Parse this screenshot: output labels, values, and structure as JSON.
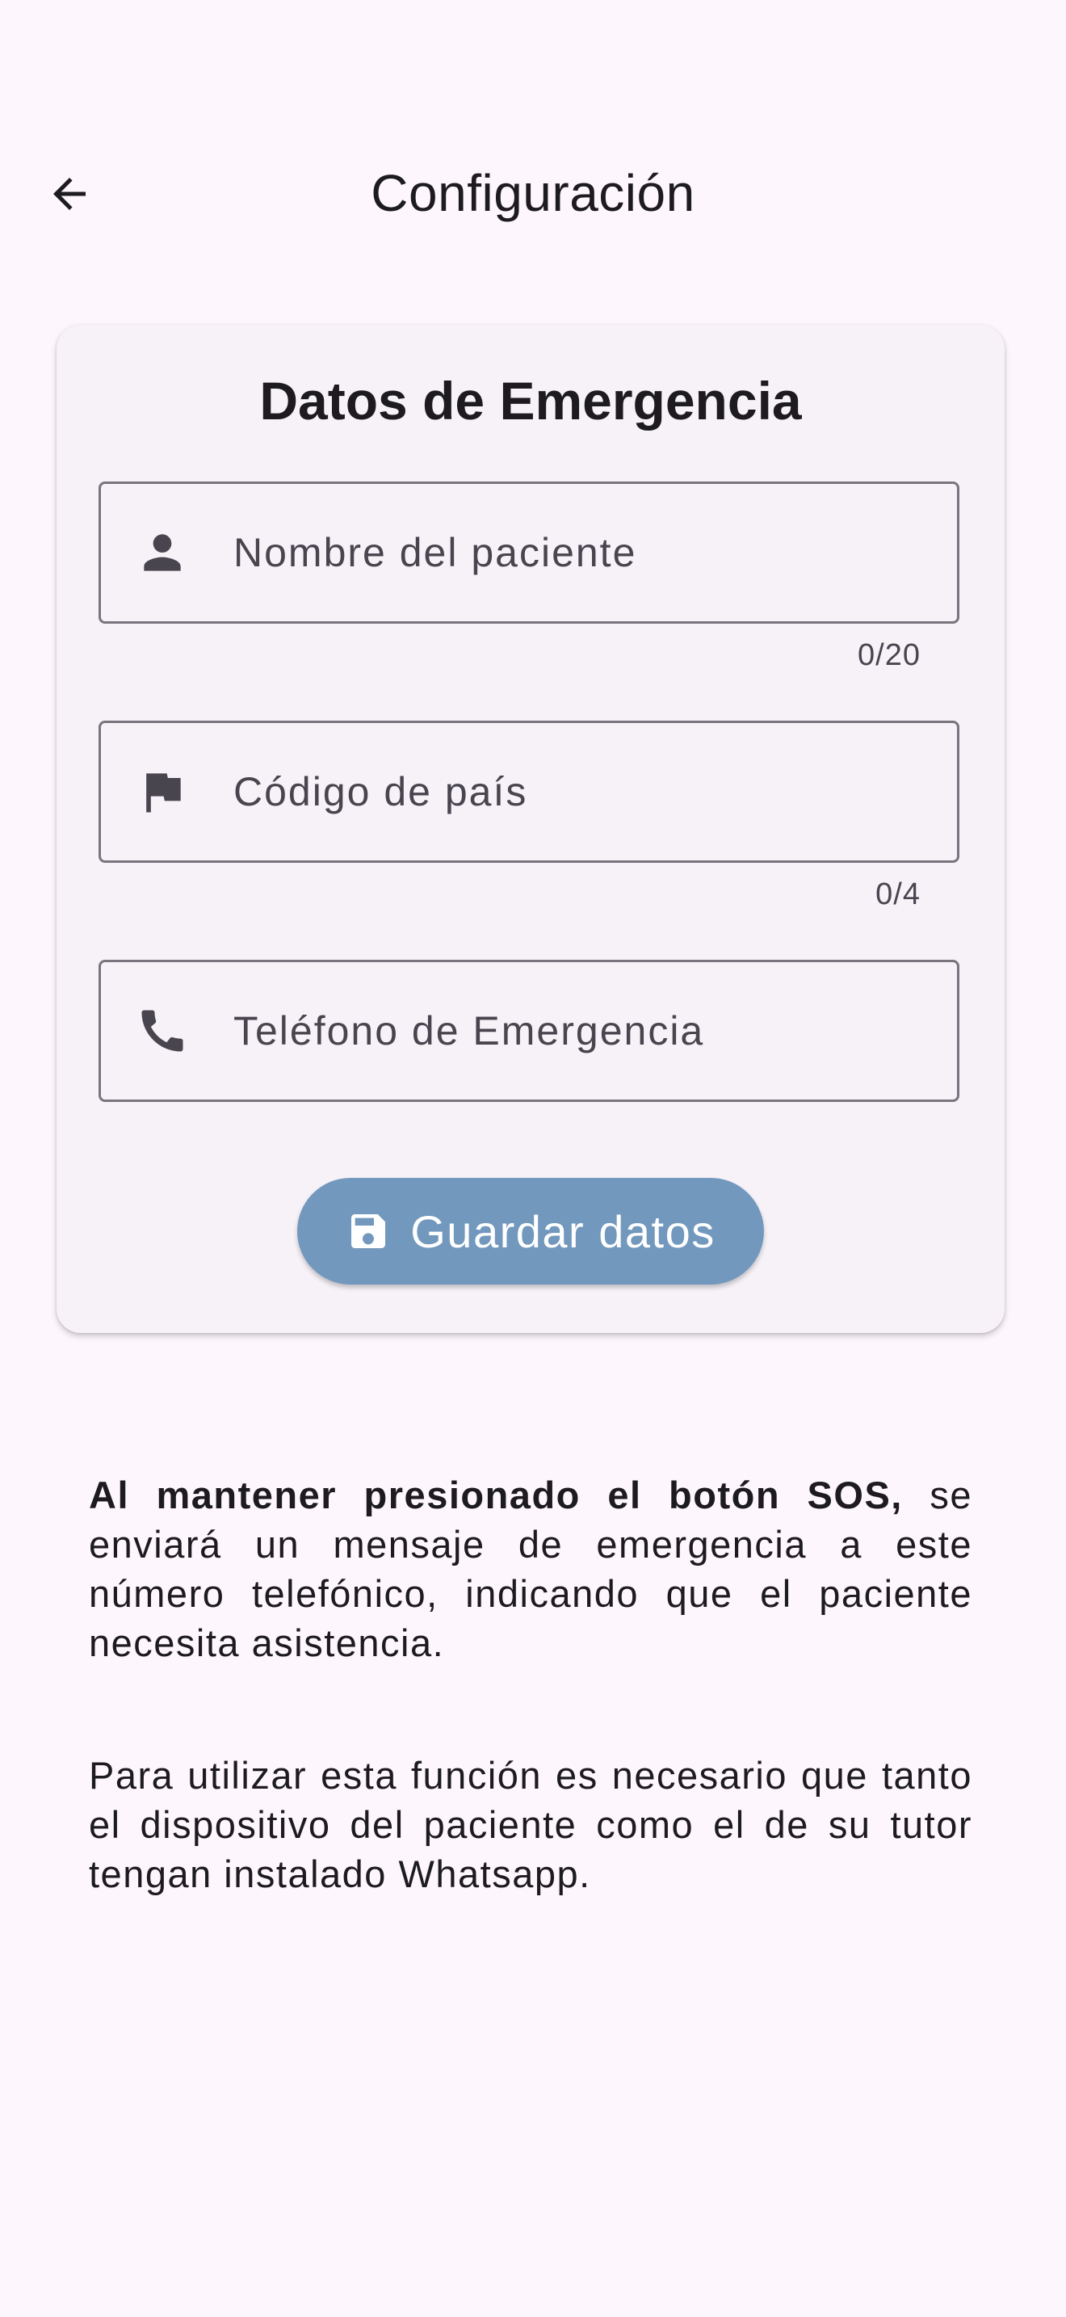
{
  "app_bar": {
    "title": "Configuración",
    "back_icon": "arrow-back-icon"
  },
  "card": {
    "title": "Datos de Emergencia",
    "fields": [
      {
        "icon": "person-icon",
        "placeholder": "Nombre del paciente",
        "value": "",
        "counter": "0/20"
      },
      {
        "icon": "flag-icon",
        "placeholder": "Código de país",
        "value": "",
        "counter": "0/4"
      },
      {
        "icon": "phone-icon",
        "placeholder": "Teléfono de Emergencia",
        "value": ""
      }
    ],
    "save_button": {
      "icon": "save-icon",
      "label": "Guardar datos",
      "color": "#7298be"
    }
  },
  "info": {
    "paragraph1_bold": "Al mantener presionado el botón SOS,",
    "paragraph1_rest": " se enviará un mensaje de emergencia a este número telefónico, indicando que el paciente necesita asistencia.",
    "paragraph2": "Para utilizar esta función es necesario que tanto el dispositivo del paciente como el de su tutor tengan instalado Whatsapp."
  },
  "colors": {
    "background": "#fdf7fd",
    "card": "#f6f2f8",
    "text": "#1d1b20",
    "outline": "#79747e"
  }
}
